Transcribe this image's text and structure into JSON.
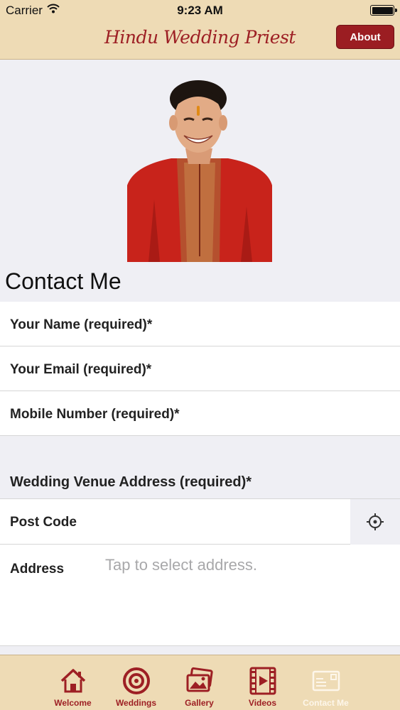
{
  "status_bar": {
    "carrier": "Carrier",
    "time": "9:23 AM"
  },
  "nav": {
    "title": "Hindu Wedding Priest",
    "about_label": "About"
  },
  "page_title": "Contact Me",
  "form": {
    "name_label": "Your Name (required)*",
    "email_label": "Your Email (required)*",
    "mobile_label": "Mobile Number (required)*",
    "venue_header": "Wedding Venue Address (required)*",
    "postcode_label": "Post Code",
    "address_label": "Address",
    "address_placeholder": "Tap to select address."
  },
  "tabs": [
    {
      "label": "Welcome",
      "icon": "home-icon"
    },
    {
      "label": "Weddings",
      "icon": "target-icon"
    },
    {
      "label": "Gallery",
      "icon": "photos-icon"
    },
    {
      "label": "Videos",
      "icon": "film-icon"
    },
    {
      "label": "Contact Me",
      "icon": "postcard-icon"
    }
  ],
  "colors": {
    "brand": "#9d1f24",
    "bar": "#eedbb5",
    "background": "#efeff4"
  }
}
